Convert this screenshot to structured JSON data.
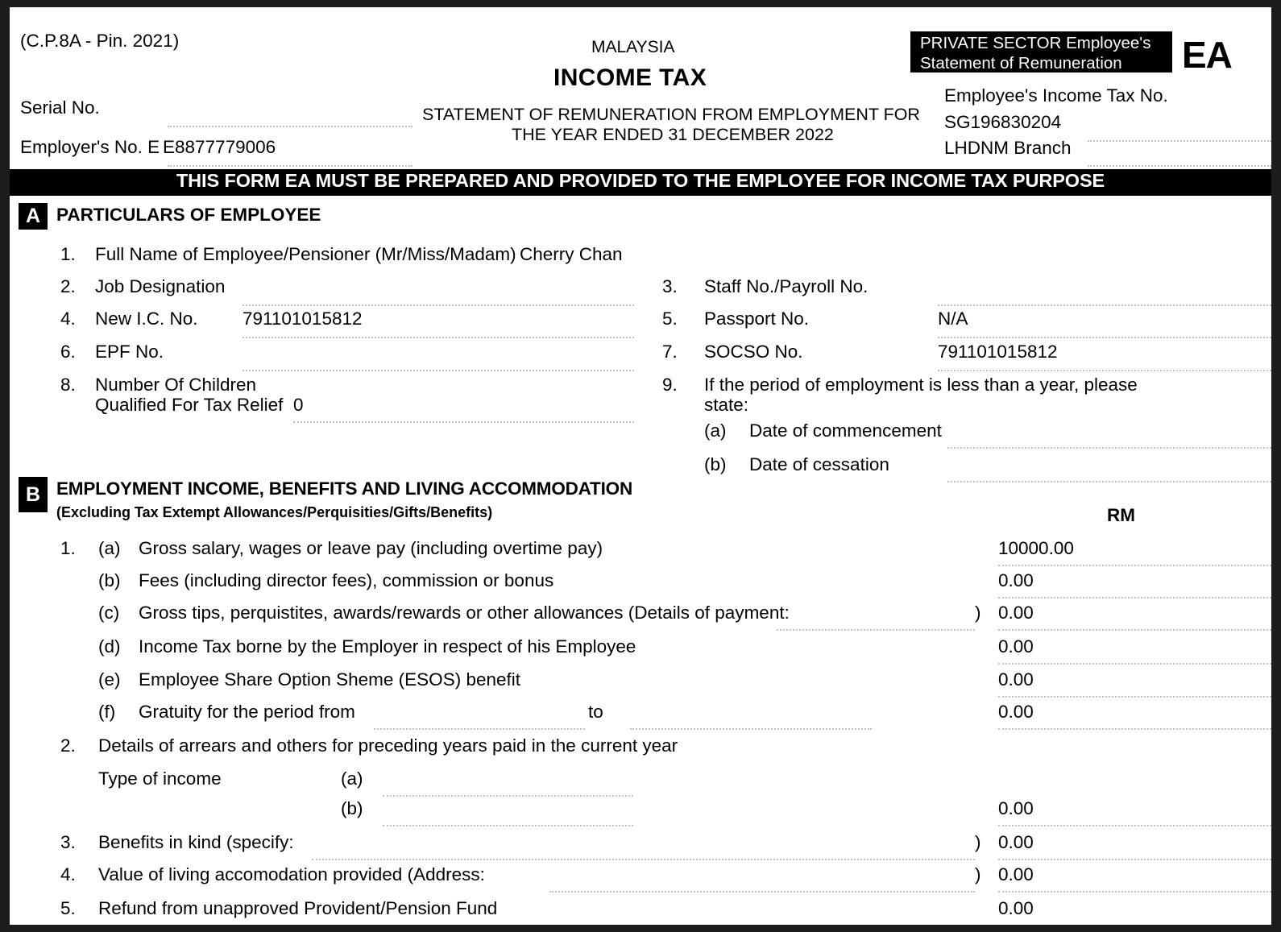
{
  "header": {
    "form_code": "(C.P.8A - Pin. 2021)",
    "serial_no_label": "Serial No.",
    "serial_no_value": "",
    "employer_no_label": "Employer's No. E",
    "employer_no_value": "E8877779006",
    "country": "MALAYSIA",
    "title": "INCOME TAX",
    "subtitle_line1": "STATEMENT OF REMUNERATION FROM EMPLOYMENT FOR",
    "subtitle_line2": "THE YEAR ENDED 31 DECEMBER 2022",
    "badge_line1": "PRIVATE SECTOR Employee's",
    "badge_line2": "Statement of Remuneration",
    "badge_ea": "EA",
    "income_tax_no_label": "Employee's Income Tax No.",
    "income_tax_no_value": "SG196830204",
    "lhdnm_branch_label": "LHDNM Branch",
    "lhdnm_branch_value": ""
  },
  "notice": "THIS FORM EA MUST BE PREPARED AND PROVIDED TO THE EMPLOYEE FOR INCOME TAX PURPOSE",
  "section_a": {
    "letter": "A",
    "title": "PARTICULARS OF EMPLOYEE",
    "item1_num": "1.",
    "item1_label": "Full Name of Employee/Pensioner (Mr/Miss/Madam)",
    "item1_value": "Cherry Chan",
    "item2_num": "2.",
    "item2_label": "Job Designation",
    "item2_value": "",
    "item3_num": "3.",
    "item3_label": "Staff No./Payroll No.",
    "item3_value": "",
    "item4_num": "4.",
    "item4_label": "New I.C. No.",
    "item4_value": "791101015812",
    "item5_num": "5.",
    "item5_label": "Passport No.",
    "item5_value": "N/A",
    "item6_num": "6.",
    "item6_label": "EPF No.",
    "item6_value": "",
    "item7_num": "7.",
    "item7_label": "SOCSO No.",
    "item7_value": "791101015812",
    "item8_num": "8.",
    "item8_label_line1": "Number Of Children",
    "item8_label_line2": "Qualified For Tax Relief",
    "item8_value": "0",
    "item9_num": "9.",
    "item9_label_line1": "If the period of employment is less than a year, please",
    "item9_label_line2": "state:",
    "item9a_letter": "(a)",
    "item9a_label": "Date of commencement",
    "item9a_value": "",
    "item9b_letter": "(b)",
    "item9b_label": "Date of cessation",
    "item9b_value": ""
  },
  "section_b": {
    "letter": "B",
    "title": "EMPLOYMENT INCOME, BENEFITS AND LIVING ACCOMMODATION",
    "subtitle": "(Excluding Tax Extempt Allowances/Perquisities/Gifts/Benefits)",
    "currency_label": "RM",
    "item1_num": "1.",
    "rows": [
      {
        "letter": "(a)",
        "label": "Gross salary, wages or leave pay (including overtime pay)",
        "amount": "10000.00"
      },
      {
        "letter": "(b)",
        "label": "Fees (including director fees), commission or bonus",
        "amount": "0.00"
      },
      {
        "letter": "(c)",
        "label": "Gross tips, perquistites, awards/rewards or other allowances (Details of payment:",
        "close_paren": ")",
        "amount": "0.00"
      },
      {
        "letter": "(d)",
        "label": "Income Tax borne by the Employer in respect of his Employee",
        "amount": "0.00"
      },
      {
        "letter": "(e)",
        "label": "Employee Share Option Sheme (ESOS) benefit",
        "amount": "0.00"
      },
      {
        "letter": "(f)",
        "label": "Gratuity for the period from",
        "label2": "to",
        "amount": "0.00"
      }
    ],
    "item2_num": "2.",
    "item2_label": "Details of arrears and others for preceding years paid in the current year",
    "item2_type_label": "Type of income",
    "item2a_letter": "(a)",
    "item2a_value": "",
    "item2b_letter": "(b)",
    "item2b_value": "",
    "item2b_amount": "0.00",
    "item3_num": "3.",
    "item3_label": "Benefits in kind (specify:",
    "item3_close_paren": ")",
    "item3_amount": "0.00",
    "item4_num": "4.",
    "item4_label": "Value of living accomodation provided (Address:",
    "item4_close_paren": ")",
    "item4_amount": "0.00",
    "item5_num": "5.",
    "item5_label": "Refund from unapproved Provident/Pension Fund",
    "item5_amount": "0.00"
  }
}
